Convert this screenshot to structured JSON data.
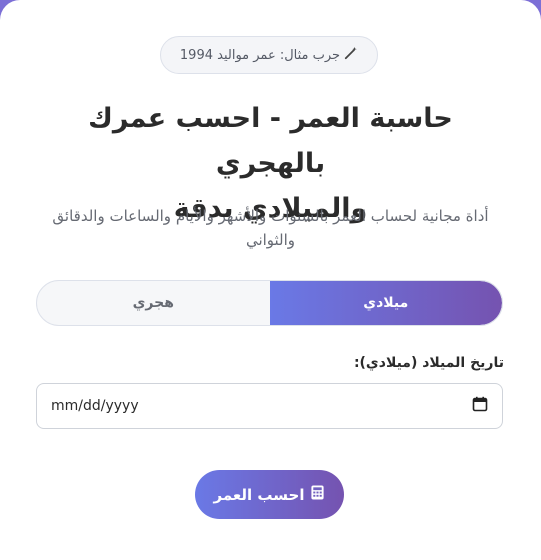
{
  "hint": {
    "text": "جرب مثال: عمر مواليد 1994",
    "icon": "magic-wand-icon"
  },
  "header": {
    "title_line1": "حاسبة العمر - احسب عمرك بالهجري",
    "title_line2": "والميلادي بدقة",
    "subtitle_line1": "أداة مجانية لحساب العمر بالسنوات والأشهر والأيام والساعات والدقائق",
    "subtitle_line2": "والثواني"
  },
  "calendar_toggle": {
    "options": [
      "ميلادي",
      "هجري"
    ],
    "selected": "ميلادي"
  },
  "birth_date": {
    "label": "تاريخ الميلاد (ميلادي):",
    "placeholder": "mm/dd/yyyy",
    "icon": "calendar-icon"
  },
  "submit": {
    "label": "احسب العمر",
    "icon": "calculator-icon"
  },
  "colors": {
    "accent_start": "#6a79e6",
    "accent_end": "#7553b0",
    "background": "#7c6fd6"
  }
}
